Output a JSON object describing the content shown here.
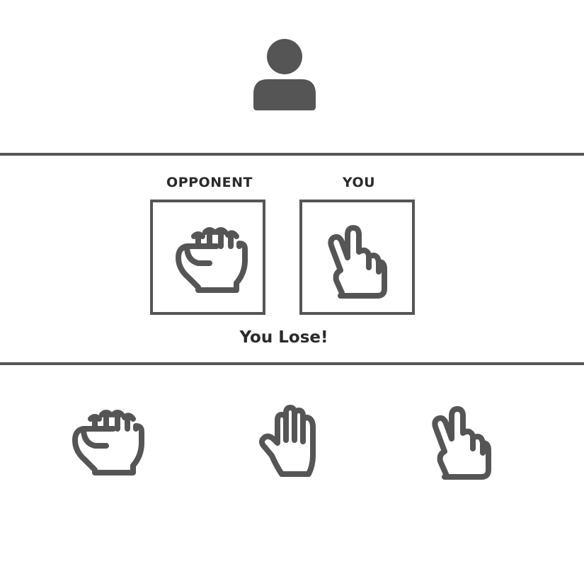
{
  "player_avatar": {
    "icon": "user-icon"
  },
  "labels": {
    "opponent": "OPPONENT",
    "you": "YOU"
  },
  "opponent_choice": {
    "icon": "rock-hand-icon"
  },
  "your_choice": {
    "icon": "scissors-hand-icon"
  },
  "result": {
    "text": "You Lose!"
  },
  "choices": [
    {
      "name": "rock",
      "icon": "rock-hand-icon"
    },
    {
      "name": "paper",
      "icon": "paper-hand-icon"
    },
    {
      "name": "scissors",
      "icon": "scissors-hand-icon"
    }
  ],
  "colors": {
    "icon": "#555555",
    "text": "#2a2a2a",
    "background": "#ffffff"
  }
}
